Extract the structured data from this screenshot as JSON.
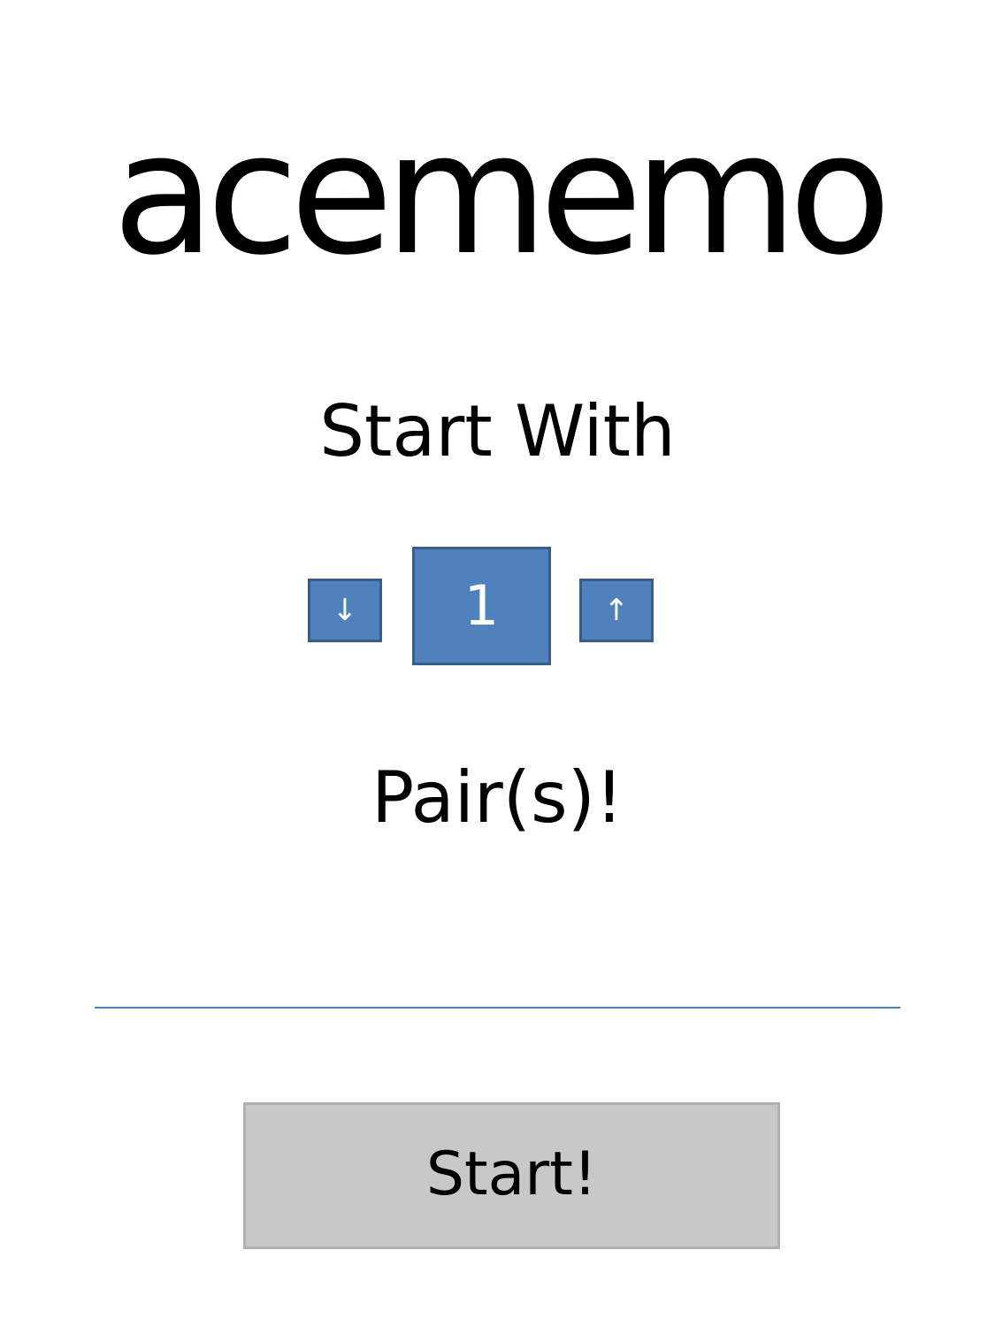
{
  "app": {
    "logo_text": "acememo"
  },
  "setup": {
    "heading": "Start With",
    "pairs_count": "1",
    "pairs_label": "Pair(s)!",
    "decrease_icon": "↓",
    "increase_icon": "↑"
  },
  "actions": {
    "start_label": "Start!"
  },
  "colors": {
    "accent": "#4f81bd",
    "accent_border": "#385d8a",
    "start_button_bg": "#c8c8c8"
  }
}
